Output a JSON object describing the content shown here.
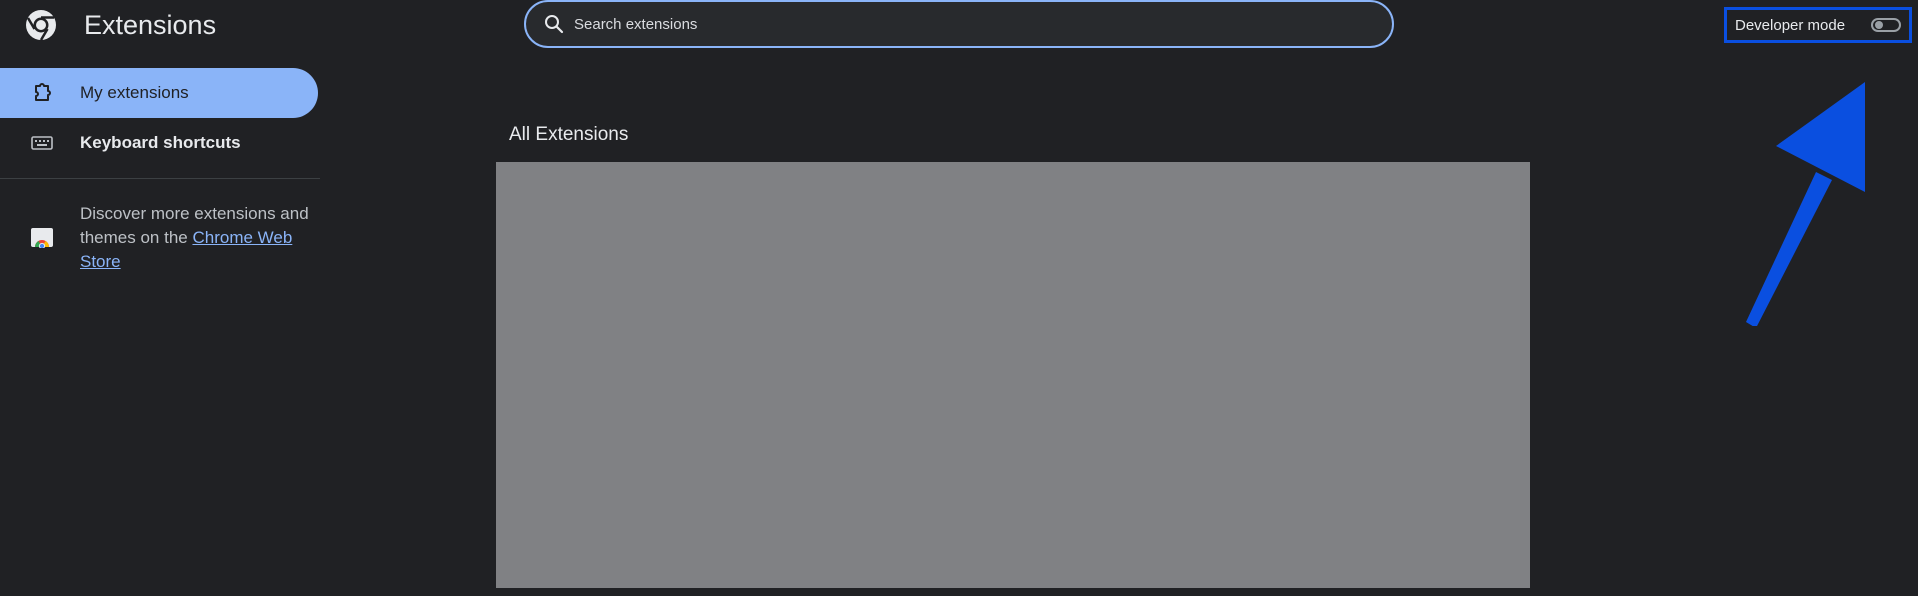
{
  "header": {
    "title": "Extensions",
    "search": {
      "placeholder": "Search extensions",
      "value": ""
    },
    "developer_mode": {
      "label": "Developer mode",
      "enabled": false
    }
  },
  "sidebar": {
    "items": [
      {
        "label": "My extensions",
        "icon": "puzzle-piece-icon",
        "active": true
      },
      {
        "label": "Keyboard shortcuts",
        "icon": "keyboard-icon",
        "active": false
      }
    ],
    "discover": {
      "text": "Discover more extensions and themes on the ",
      "link_text": "Chrome Web Store",
      "icon": "chrome-web-store-icon"
    }
  },
  "main": {
    "section_title": "All Extensions"
  },
  "colors": {
    "background": "#202124",
    "accent": "#8ab4f8",
    "annotation": "#0a4fe0",
    "content_block": "#808184"
  }
}
